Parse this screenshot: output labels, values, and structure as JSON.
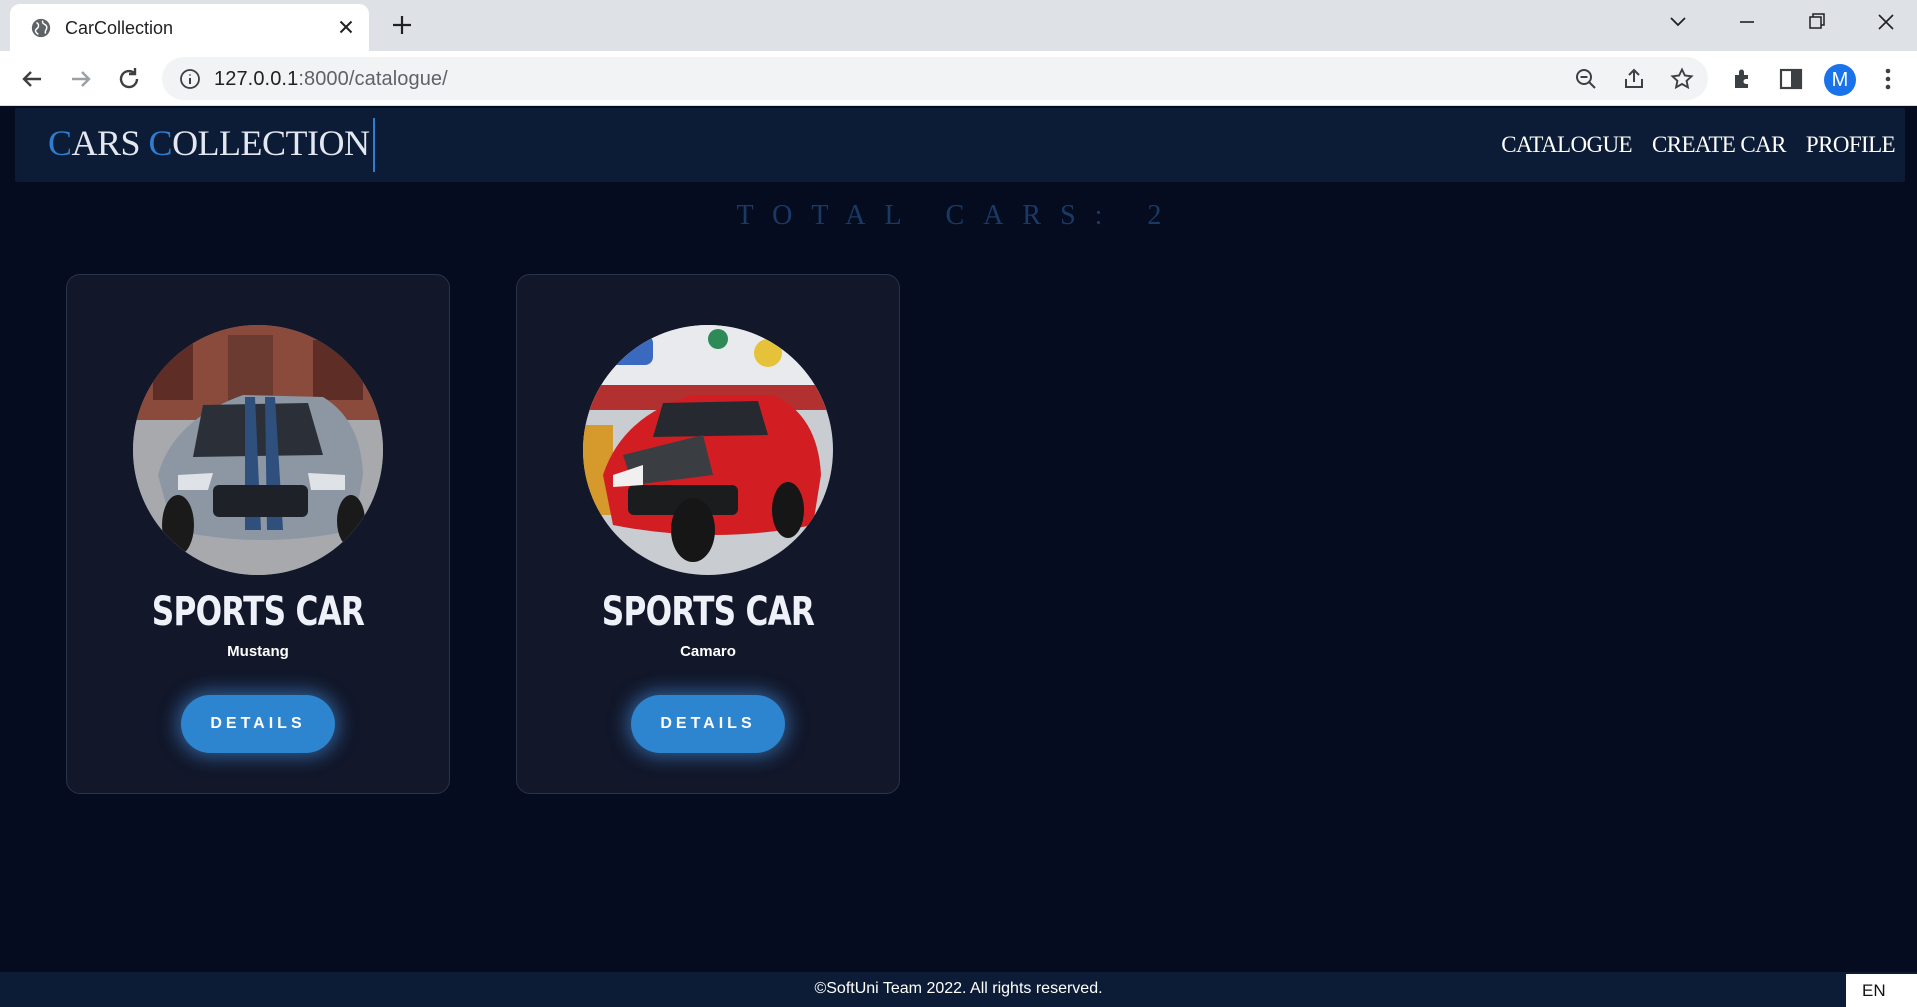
{
  "browser": {
    "tab_title": "CarCollection",
    "url_host": "127.0.0.1",
    "url_path": ":8000/catalogue/",
    "avatar_letter": "M"
  },
  "header": {
    "logo_first_initial": "C",
    "logo_first_rest": "ARS ",
    "logo_second_initial": "C",
    "logo_second_rest": "OLLECTION",
    "nav": [
      "CATALOGUE",
      "CREATE CAR",
      "PROFILE"
    ]
  },
  "catalogue": {
    "total_label": "TOTAL CARS: 2",
    "cars": [
      {
        "type": "SPORTS CAR",
        "model": "Mustang",
        "button": "DETAILS",
        "photo_icon": "mustang-photo"
      },
      {
        "type": "SPORTS CAR",
        "model": "Camaro",
        "button": "DETAILS",
        "photo_icon": "camaro-photo"
      }
    ]
  },
  "footer": {
    "text": "©SoftUni Team 2022. All rights reserved."
  },
  "taskbar": {
    "language": "EN"
  },
  "colors": {
    "page_bg": "#060c20",
    "header_bg": "#0d1c36",
    "accent": "#2f7dd0",
    "button": "#2d84cf",
    "card_bg": "#12172a"
  }
}
